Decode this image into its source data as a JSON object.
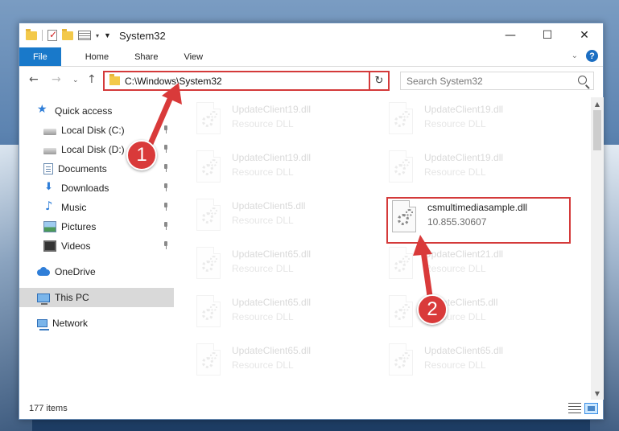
{
  "window": {
    "title": "System32",
    "min_glyph": "—",
    "max_glyph": "☐",
    "close_glyph": "✕"
  },
  "ribbon": {
    "tabs": [
      "File",
      "Home",
      "Share",
      "View"
    ],
    "help_glyph": "?"
  },
  "address": {
    "path": "C:\\Windows\\System32",
    "search_placeholder": "Search System32"
  },
  "nav_pane": {
    "items": [
      {
        "label": "Quick access",
        "icon": "star-icon"
      },
      {
        "label": "Local Disk (C:)",
        "icon": "disk-icon",
        "pinned": true
      },
      {
        "label": "Local Disk (D:)",
        "icon": "disk-icon",
        "pinned": true
      },
      {
        "label": "Documents",
        "icon": "documents-icon",
        "pinned": true
      },
      {
        "label": "Downloads",
        "icon": "download-icon",
        "pinned": true
      },
      {
        "label": "Music",
        "icon": "music-icon",
        "pinned": true
      },
      {
        "label": "Pictures",
        "icon": "pictures-icon",
        "pinned": true
      },
      {
        "label": "Videos",
        "icon": "videos-icon",
        "pinned": true
      },
      {
        "label": "OneDrive",
        "icon": "cloud-icon"
      },
      {
        "label": "This PC",
        "icon": "pc-icon",
        "selected": true
      },
      {
        "label": "Network",
        "icon": "network-icon"
      }
    ]
  },
  "files": {
    "left": [
      {
        "name": "UpdateClient19.dll",
        "type": "Resource DLL"
      },
      {
        "name": "UpdateClient19.dll",
        "type": "Resource DLL"
      },
      {
        "name": "UpdateClient5.dll",
        "type": "Resource DLL"
      },
      {
        "name": "UpdateClient65.dll",
        "type": "Resource DLL"
      },
      {
        "name": "UpdateClient65.dll",
        "type": "Resource DLL"
      },
      {
        "name": "UpdateClient65.dll",
        "type": "Resource DLL"
      }
    ],
    "right": [
      {
        "name": "UpdateClient19.dll",
        "type": "Resource DLL"
      },
      {
        "name": "UpdateClient19.dll",
        "type": "Resource DLL"
      },
      {
        "name": "csmultimediasample.dll",
        "type": "10.855.30607",
        "highlighted": true
      },
      {
        "name": "UpdateClient21.dll",
        "type": "Resource DLL"
      },
      {
        "name": "UpdateClient5.dll",
        "type": "Resource DLL"
      },
      {
        "name": "UpdateClient65.dll",
        "type": "Resource DLL"
      }
    ]
  },
  "status": {
    "item_count": "177 items"
  },
  "callouts": [
    "1",
    "2"
  ],
  "colors": {
    "accent": "#1979ca",
    "highlight": "#d43a3a"
  }
}
